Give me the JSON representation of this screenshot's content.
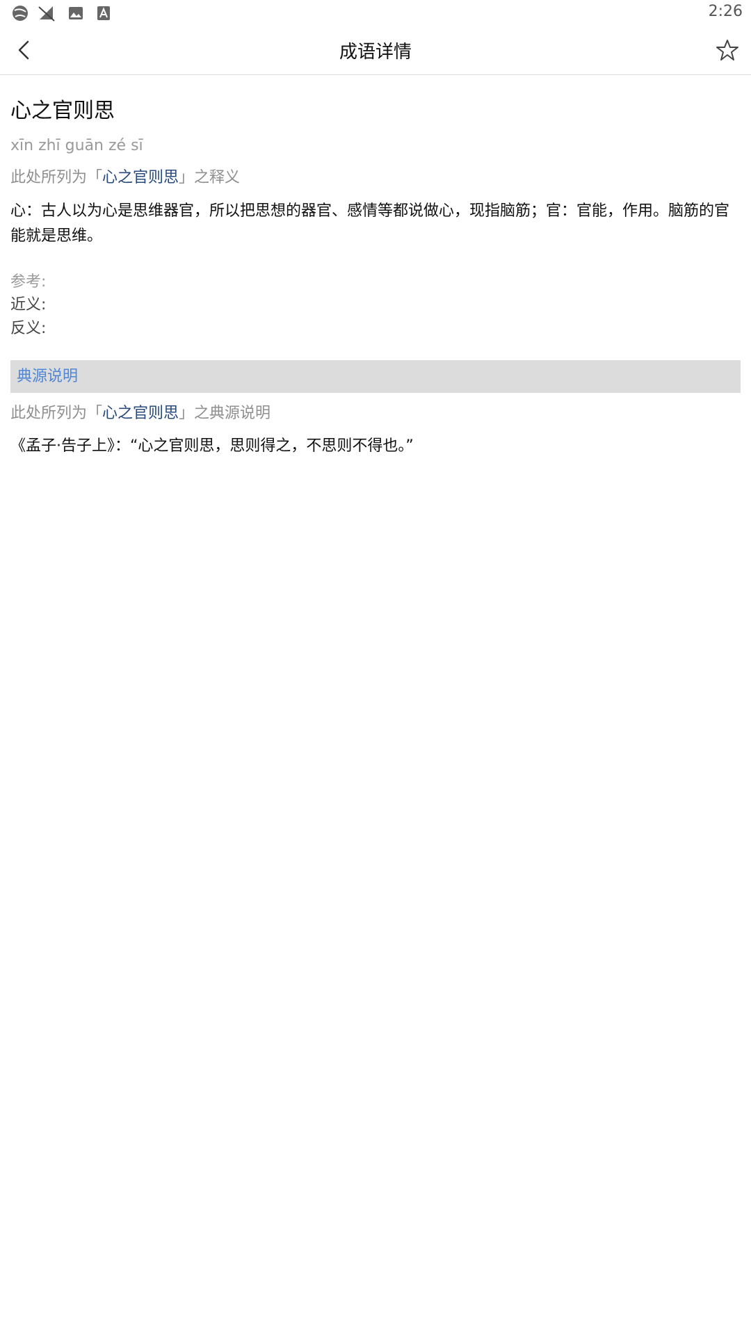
{
  "status_bar": {
    "time": "2:26",
    "icons": [
      "globe-icon",
      "no-signal-icon",
      "image-icon",
      "a-icon"
    ]
  },
  "app_bar": {
    "title": "成语详情",
    "back_icon": "back-arrow-icon",
    "star_icon": "star-icon"
  },
  "idiom": {
    "title": "心之官则思",
    "pinyin": "xīn zhī guān zé sī",
    "meaning_prefix": "此处所列为「",
    "meaning_highlight": "心之官则思",
    "meaning_suffix": "」之释义",
    "definition": "心：古人以为心是思维器官，所以把思想的器官、感情等都说做心，现指脑筋；官：官能，作用。脑筋的官能就是思维。"
  },
  "reference": {
    "label": "参考:",
    "synonym_label": "近义:",
    "antonym_label": "反义:"
  },
  "source": {
    "section_title": "典源说明",
    "prefix": "此处所列为「",
    "highlight": "心之官则思",
    "suffix": "」之典源说明",
    "text": "《孟子·告子上》：“心之官则思，思则得之，不思则不得也。”"
  },
  "colors": {
    "accent": "#4f86d6",
    "highlight": "#27497f",
    "section_bg": "#dcdcdc"
  }
}
